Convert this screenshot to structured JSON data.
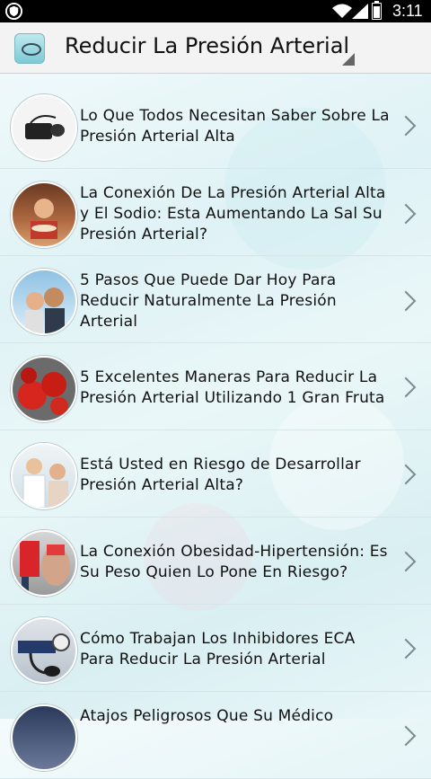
{
  "status_bar": {
    "time": "3:11"
  },
  "header": {
    "title": "Reducir La Presión Arterial"
  },
  "articles": [
    {
      "title": "Lo Que Todos Necesitan Saber Sobre La Presión Arterial Alta",
      "image": "blood-pressure-monitor"
    },
    {
      "title": "La Conexión De La Presión Arterial Alta y El Sodio: Esta Aumentando La Sal Su Presión Arterial?",
      "image": "woman-eating"
    },
    {
      "title": "5 Pasos Que Puede Dar Hoy Para Reducir Naturalmente La Presión Arterial",
      "image": "couple-outdoors"
    },
    {
      "title": "5 Excelentes Maneras Para Reducir La Presión Arterial Utilizando 1 Gran Fruta",
      "image": "tomatoes"
    },
    {
      "title": "Está Usted en Riesgo de Desarrollar Presión Arterial Alta?",
      "image": "doctor-patient"
    },
    {
      "title": "La Conexión Obesidad-Hipertensión: Es Su Peso Quien Lo Pone En Riesgo?",
      "image": "overweight-people"
    },
    {
      "title": "Cómo Trabajan Los Inhibidores ECA Para Reducir La Presión Arterial",
      "image": "sphygmomanometer"
    },
    {
      "title": "Atajos Peligrosos Que Su Médico",
      "image": "medical-device"
    }
  ]
}
